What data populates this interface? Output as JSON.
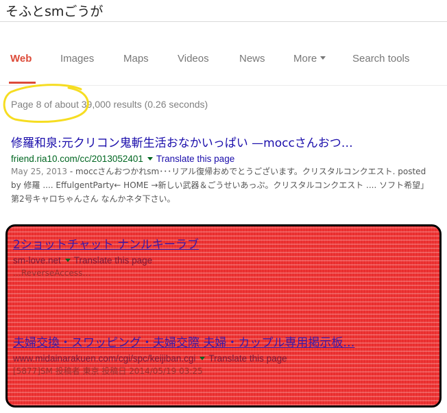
{
  "search": {
    "query": "そふとsmごうが"
  },
  "tabs": [
    {
      "label": "Web"
    },
    {
      "label": "Images"
    },
    {
      "label": "Maps"
    },
    {
      "label": "Videos"
    },
    {
      "label": "News"
    },
    {
      "label": "More"
    },
    {
      "label": "Search tools"
    }
  ],
  "stats": {
    "text": "Page 8 of about 39,000 results (0.26 seconds)"
  },
  "results": [
    {
      "title": "修羅和泉:元クリコン鬼斬生活おなかいっぱい —moccさんおつ…",
      "url": "friend.ria10.com/cc/2013052401",
      "translate": "Translate this page",
      "date": "May 25, 2013",
      "snippet": "moccさんおつかれsm･･･リアル復帰おめでとうございます。クリスタルコンクエスト. posted by 修羅 .... EffulgentParty← HOME →新しい武器＆ごうせいあっぷ。クリスタルコンクエスト .... ソフト希望」第2号キャロちゃんさん なんかネタ下さい。"
    },
    {
      "title": "2ショットチャット ナンルキーラブ",
      "url": "sm-love.net",
      "translate": "Translate this page",
      "snippet": "…ReverseAccess…"
    },
    {
      "title": "夫婦交換・スワッピング・夫婦交際 夫婦・カップル専用掲示板…",
      "url": "www.midainarakuen.com/cgi/spc/keijiban.cgi",
      "translate": "Translate this page",
      "snippet": "[5877]SM 投稿者 東京 投稿日 2014/05/19 03:25"
    }
  ],
  "colors": {
    "accent": "#dd4b39",
    "link": "#1a0dab",
    "url": "#006621",
    "highlighter": "#f5d90a",
    "redaction": "#ee3535"
  }
}
